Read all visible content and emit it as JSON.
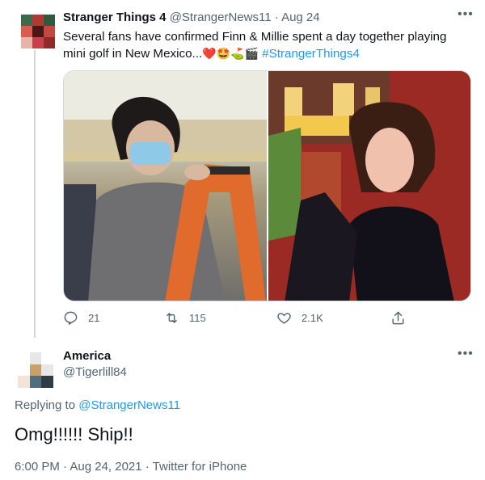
{
  "tweet": {
    "author_name": "Stranger Things 4",
    "author_handle": "@StrangerNews11",
    "date_sep": "·",
    "date": "Aug 24",
    "text_line1": "Several fans have confirmed Finn & Millie spent a day together playing",
    "text_line2": "mini golf in New Mexico...",
    "emojis": [
      "❤️",
      "🤩",
      "⛳",
      "🎬"
    ],
    "hashtag": "#StrangerThings4",
    "actions": {
      "reply_count": "21",
      "retweet_count": "115",
      "like_count": "2.1K"
    }
  },
  "reply": {
    "author_name": "America",
    "author_handle": "@Tigerlill84",
    "replying_prefix": "Replying to",
    "replying_to": "@StrangerNews11",
    "text": "Omg!!!!!! Ship!!",
    "timestamp": "6:00 PM · Aug 24, 2021 · Twitter for iPhone"
  },
  "colors": {
    "link": "#1d9bf0",
    "secondary_text": "#536471",
    "heart": "#e0245e"
  }
}
